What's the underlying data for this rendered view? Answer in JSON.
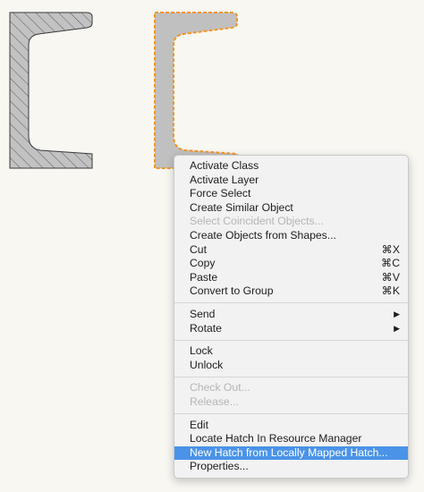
{
  "canvas": {
    "left_shape": "channel-section-hatched",
    "right_shape": "channel-section-selected",
    "selection_color": "#f0962a",
    "fill_color": "#c0c0c0"
  },
  "context_menu": {
    "groups": [
      {
        "items": [
          {
            "label": "Activate Class",
            "enabled": true
          },
          {
            "label": "Activate Layer",
            "enabled": true
          },
          {
            "label": "Force Select",
            "enabled": true
          },
          {
            "label": "Create Similar Object",
            "enabled": true
          },
          {
            "label": "Select Coincident Objects...",
            "enabled": false
          },
          {
            "label": "Create Objects from Shapes...",
            "enabled": true
          },
          {
            "label": "Cut",
            "shortcut": "⌘X",
            "enabled": true
          },
          {
            "label": "Copy",
            "shortcut": "⌘C",
            "enabled": true
          },
          {
            "label": "Paste",
            "shortcut": "⌘V",
            "enabled": true
          },
          {
            "label": "Convert to Group",
            "shortcut": "⌘K",
            "enabled": true
          }
        ]
      },
      {
        "items": [
          {
            "label": "Send",
            "submenu": true,
            "enabled": true
          },
          {
            "label": "Rotate",
            "submenu": true,
            "enabled": true
          }
        ]
      },
      {
        "items": [
          {
            "label": "Lock",
            "enabled": true
          },
          {
            "label": "Unlock",
            "enabled": true
          }
        ]
      },
      {
        "items": [
          {
            "label": "Check Out...",
            "enabled": false
          },
          {
            "label": "Release...",
            "enabled": false
          }
        ]
      },
      {
        "items": [
          {
            "label": "Edit",
            "enabled": true
          },
          {
            "label": "Locate Hatch In Resource Manager",
            "enabled": true
          },
          {
            "label": "New Hatch from Locally Mapped Hatch...",
            "enabled": true,
            "highlighted": true
          },
          {
            "label": "Properties...",
            "enabled": true
          }
        ]
      }
    ],
    "submenu_arrow": "▶",
    "highlight_color": "#4a93e8"
  }
}
